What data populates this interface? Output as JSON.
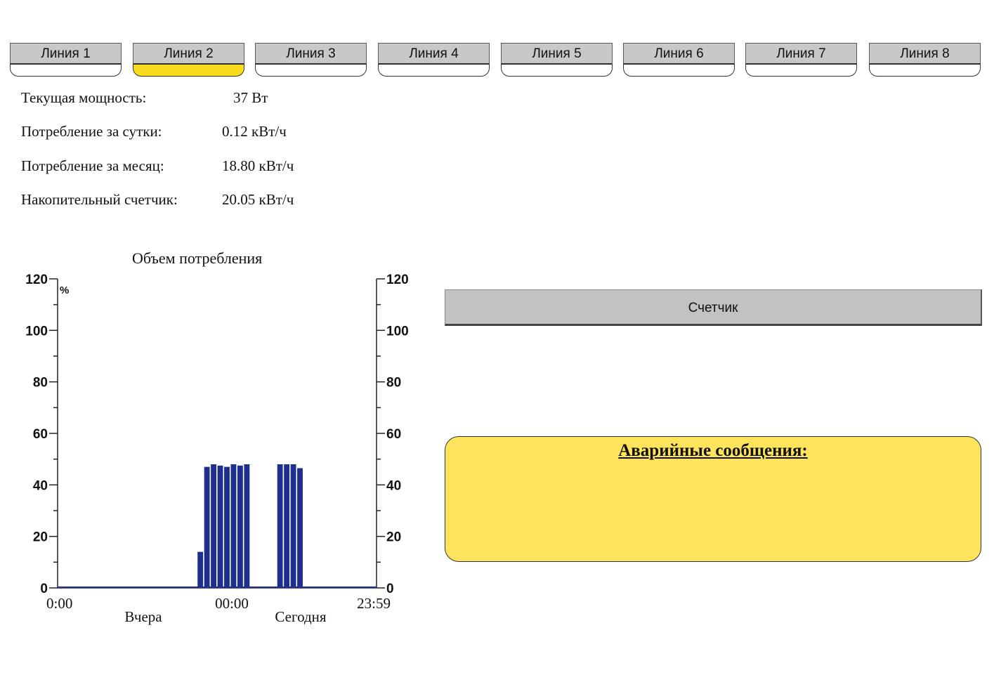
{
  "tabs": [
    {
      "label": "Линия 1",
      "active": false
    },
    {
      "label": "Линия 2",
      "active": true
    },
    {
      "label": "Линия 3",
      "active": false
    },
    {
      "label": "Линия 4",
      "active": false
    },
    {
      "label": "Линия 5",
      "active": false
    },
    {
      "label": "Линия 6",
      "active": false
    },
    {
      "label": "Линия 7",
      "active": false
    },
    {
      "label": "Линия 8",
      "active": false
    }
  ],
  "stats": [
    {
      "label": "Текущая мощность:",
      "value": "37  Вт"
    },
    {
      "label": "Потребление за сутки:",
      "value": "0.12 кВт/ч"
    },
    {
      "label": "Потребление за месяц:",
      "value": "18.80 кВт/ч"
    },
    {
      "label": "Накопительный счетчик:",
      "value": "20.05 кВт/ч"
    }
  ],
  "chart": {
    "title": "Объем потребления"
  },
  "counter_button": {
    "label": "Счетчик"
  },
  "alarm": {
    "title": "Аварийные сообщения:"
  },
  "colors": {
    "bar": "#1f2f8f",
    "active_indicator": "#f9dc1d",
    "alarm_bg": "#fee45c"
  },
  "chart_data": {
    "type": "bar",
    "title": "Объем потребления",
    "y_unit": "%",
    "ylim": [
      0,
      120
    ],
    "y_ticks": [
      "0",
      "20",
      "40",
      "60",
      "80",
      "100",
      "120"
    ],
    "right_tick_labels": [
      "0",
      "20",
      "40",
      "60",
      "80",
      "100",
      "120"
    ],
    "x_tick_labels": [
      "0:00",
      "00:00",
      "23:59"
    ],
    "day_labels": [
      "Вчера",
      "Сегодня"
    ],
    "hours_total": 48,
    "series": [
      {
        "values": [
          0,
          0,
          0,
          0,
          0,
          0,
          0,
          0,
          0,
          0,
          0,
          0,
          0,
          0,
          0,
          0,
          0,
          0,
          0,
          0,
          0,
          0,
          0,
          0,
          0,
          14,
          47,
          48,
          47.5,
          47,
          48,
          47.5,
          48,
          0,
          0,
          0,
          0,
          0,
          0,
          0,
          0,
          0,
          0,
          0,
          0,
          0,
          0,
          0,
          0,
          0
        ],
        "values_note": ""
      }
    ],
    "hour_values": [
      0,
      0,
      0,
      0,
      0,
      0,
      0,
      0,
      0,
      0,
      0,
      0,
      0,
      0,
      0,
      0,
      0,
      0,
      0,
      0,
      0,
      14,
      47,
      48,
      47.5,
      47,
      48,
      47.5,
      48,
      0,
      0,
      0,
      0,
      48,
      48,
      48,
      46.5,
      0,
      0,
      0,
      0,
      0,
      0,
      0,
      0,
      0,
      0,
      0
    ]
  }
}
